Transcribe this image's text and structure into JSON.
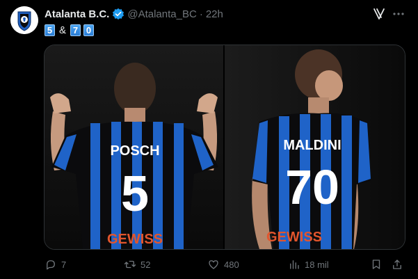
{
  "post": {
    "display_name": "Atalanta B.C.",
    "handle": "@Atalanta_BC",
    "separator": "·",
    "time": "22h",
    "text_keys": [
      "5",
      "7",
      "0"
    ],
    "text_amp": "&"
  },
  "media": {
    "left_photo": {
      "name_on_shirt": "POSCH",
      "number_on_shirt": "5",
      "sponsor": "GEWISS"
    },
    "right_photo": {
      "name_on_shirt": "MALDINI",
      "number_on_shirt": "70",
      "sponsor": "GEWISS"
    }
  },
  "actions": {
    "reply_count": "7",
    "repost_count": "52",
    "like_count": "480",
    "views_count": "18 mil"
  },
  "colors": {
    "background": "#000000",
    "text": "#e7e9ea",
    "muted": "#71767b",
    "verified": "#1d9bf0",
    "kit_blue": "#1f63c8",
    "kit_black": "#0b0b0d",
    "sponsor_orange": "#e2552d"
  },
  "icons": [
    "verified-badge-icon",
    "grok-icon",
    "more-icon",
    "reply-icon",
    "repost-icon",
    "like-icon",
    "views-icon",
    "bookmark-icon",
    "share-icon"
  ]
}
